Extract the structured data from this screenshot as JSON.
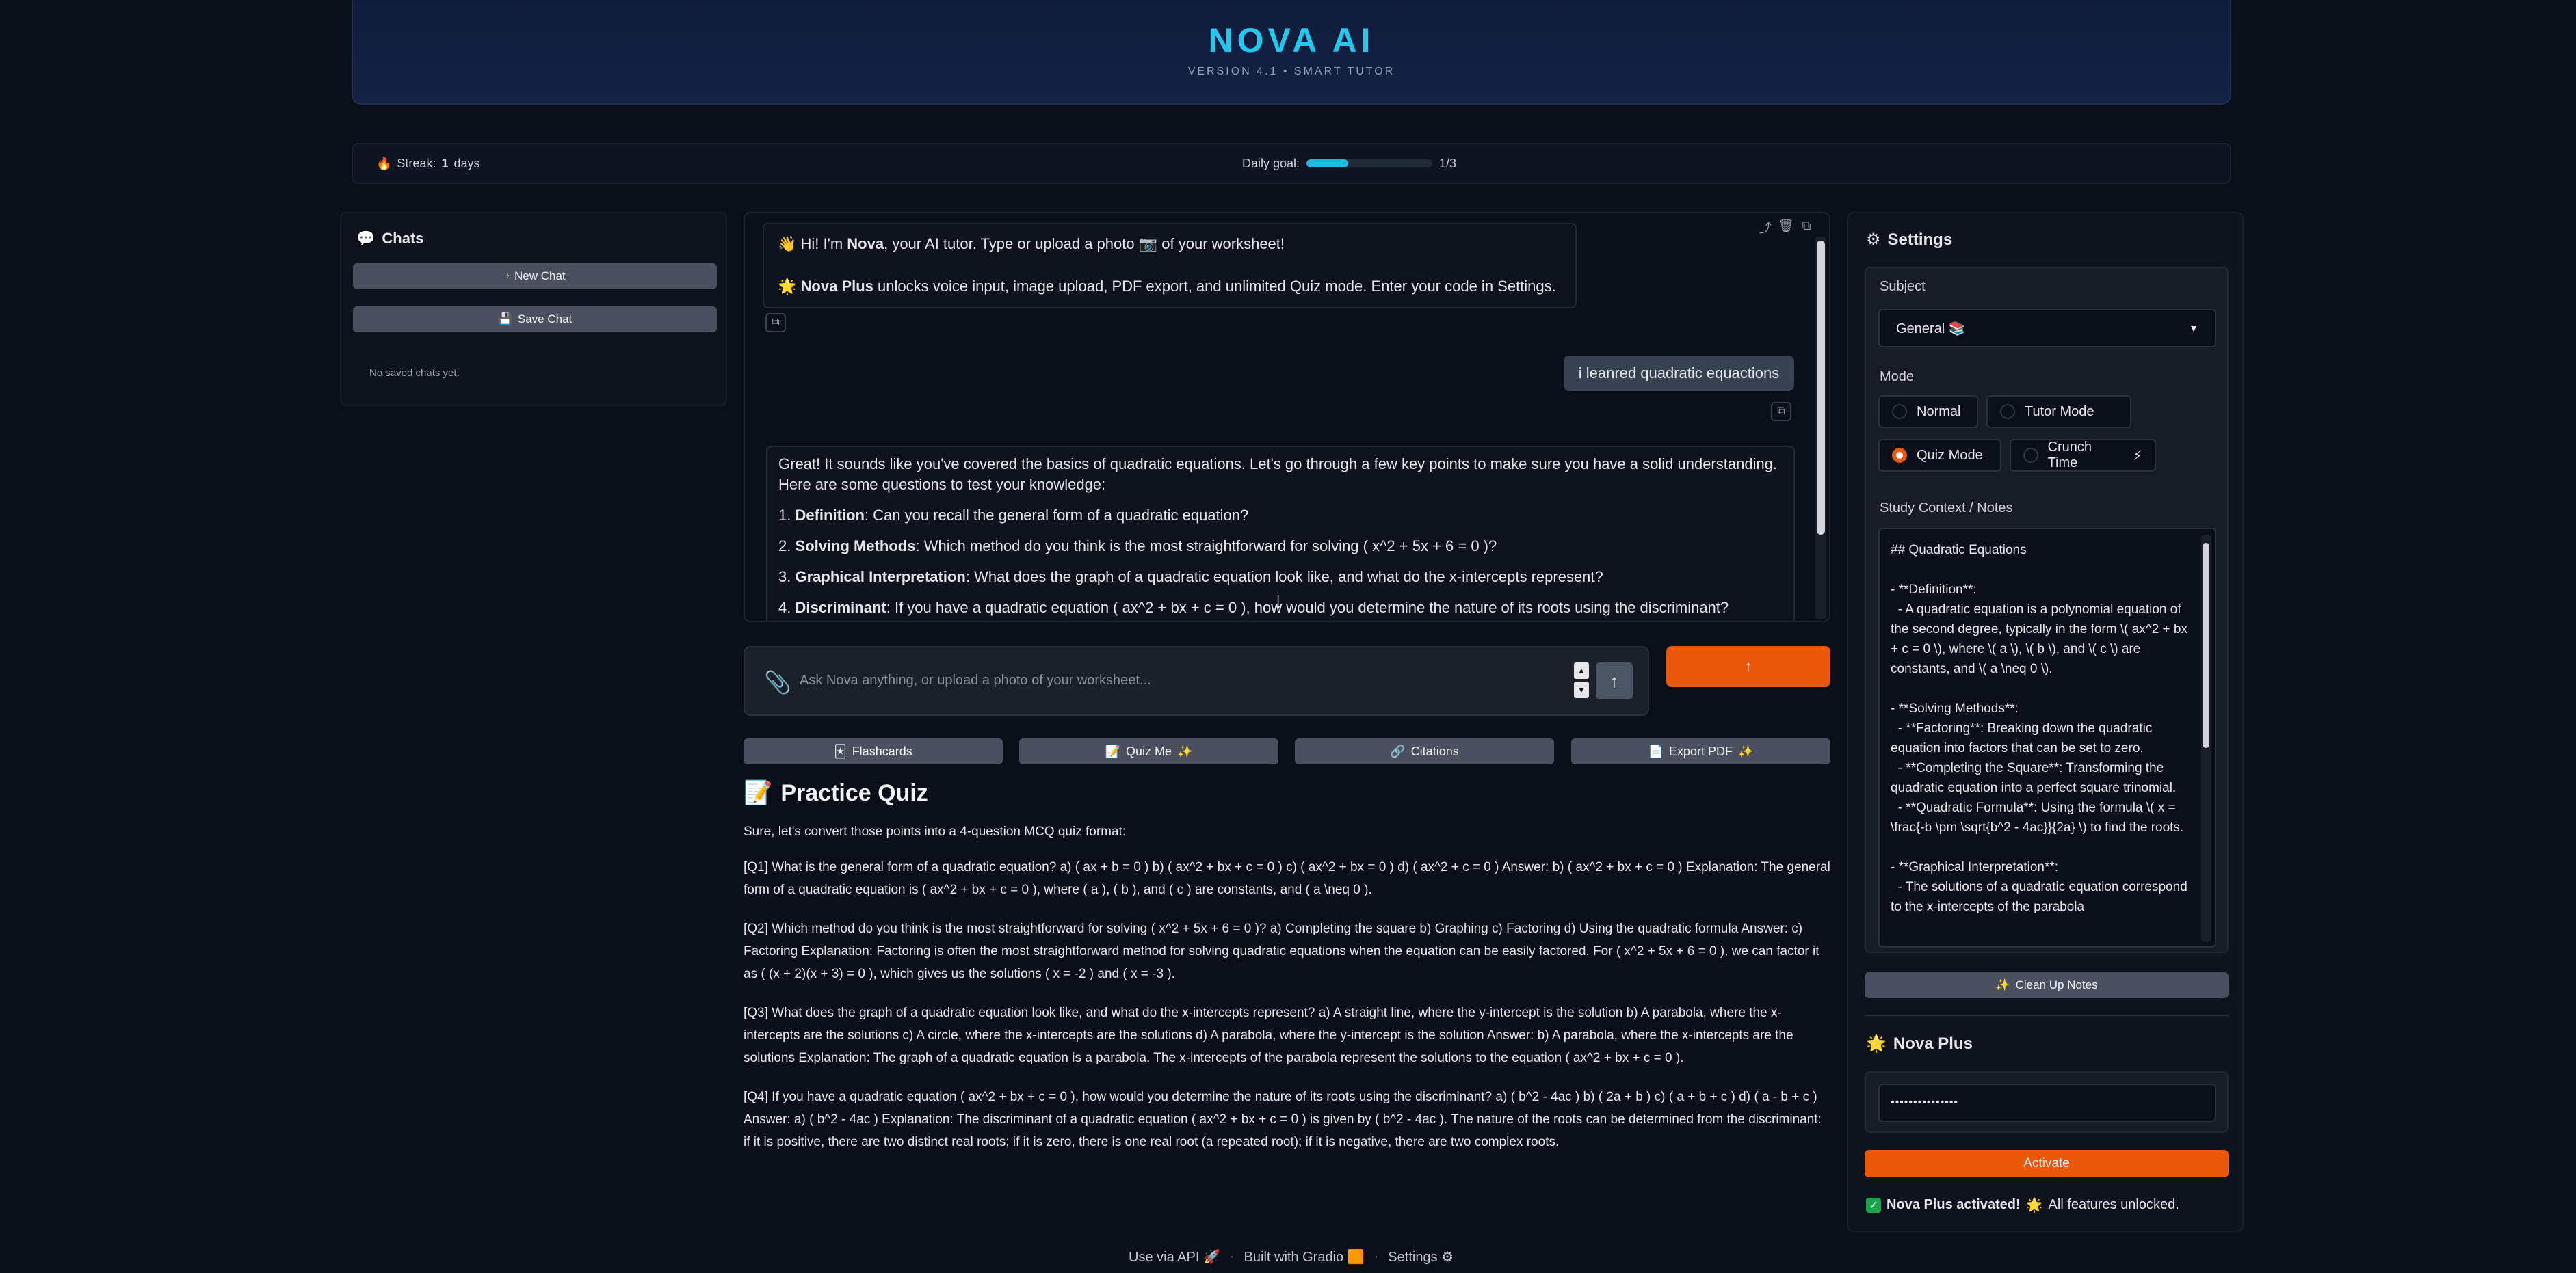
{
  "header": {
    "brand": "NOVA AI",
    "version": "VERSION 4.1 • SMART TUTOR"
  },
  "status": {
    "streak_label": "Streak:",
    "streak_value": "1",
    "streak_unit": "days",
    "goal_label": "Daily goal:",
    "goal_text": "1/3",
    "goal_progress": 0.33
  },
  "chats": {
    "title": "Chats",
    "new_chat": "+ New Chat",
    "save_chat": "Save Chat",
    "empty": "No saved chats yet."
  },
  "chat": {
    "greeting_line1_pre": "Hi! I'm ",
    "greeting_name": "Nova",
    "greeting_line1_post": ", your AI tutor. Type or upload a photo",
    "greeting_line1_end": "of your worksheet!",
    "greeting_line2_bold": "Nova Plus",
    "greeting_line2": " unlocks voice input, image upload, PDF export, and unlimited Quiz mode. Enter your code in Settings.",
    "user_message": "i leanred quadratic equactions",
    "bot_intro": "Great! It sounds like you've covered the basics of quadratic equations. Let's go through a few key points to make sure you have a solid understanding. Here are some questions to test your knowledge:",
    "bot_points": [
      {
        "num": "1. ",
        "bold": "Definition",
        "text": ": Can you recall the general form of a quadratic equation?"
      },
      {
        "num": "2. ",
        "bold": "Solving Methods",
        "text": ": Which method do you think is the most straightforward for solving ( x^2 + 5x + 6 = 0 )?"
      },
      {
        "num": "3. ",
        "bold": "Graphical Interpretation",
        "text": ": What does the graph of a quadratic equation look like, and what do the x-intercepts represent?"
      },
      {
        "num": "4. ",
        "bold": "Discriminant",
        "text": ": If you have a quadratic equation ( ax^2 + bx + c = 0 ), how would you determine the nature of its roots using the discriminant?"
      }
    ]
  },
  "input": {
    "placeholder": "Ask Nova anything, or upload a photo of your worksheet..."
  },
  "actions": {
    "flashcards": "Flashcards",
    "quiz_me": "Quiz Me",
    "citations": "Citations",
    "export_pdf": "Export PDF"
  },
  "quiz": {
    "title": "Practice Quiz",
    "intro": "Sure, let's convert those points into a 4-question MCQ quiz format:",
    "questions": [
      "[Q1] What is the general form of a quadratic equation? a) ( ax + b = 0 ) b) ( ax^2 + bx + c = 0 ) c) ( ax^2 + bx = 0 ) d) ( ax^2 + c = 0 ) Answer: b) ( ax^2 + bx + c = 0 ) Explanation: The general form of a quadratic equation is ( ax^2 + bx + c = 0 ), where ( a ), ( b ), and ( c ) are constants, and ( a \\neq 0 ).",
      "[Q2] Which method do you think is the most straightforward for solving ( x^2 + 5x + 6 = 0 )? a) Completing the square b) Graphing c) Factoring d) Using the quadratic formula Answer: c) Factoring Explanation: Factoring is often the most straightforward method for solving quadratic equations when the equation can be easily factored. For ( x^2 + 5x + 6 = 0 ), we can factor it as ( (x + 2)(x + 3) = 0 ), which gives us the solutions ( x = -2 ) and ( x = -3 ).",
      "[Q3] What does the graph of a quadratic equation look like, and what do the x-intercepts represent? a) A straight line, where the y-intercept is the solution b) A parabola, where the x-intercepts are the solutions c) A circle, where the x-intercepts are the solutions d) A parabola, where the y-intercept is the solution Answer: b) A parabola, where the x-intercepts are the solutions Explanation: The graph of a quadratic equation is a parabola. The x-intercepts of the parabola represent the solutions to the equation ( ax^2 + bx + c = 0 ).",
      "[Q4] If you have a quadratic equation ( ax^2 + bx + c = 0 ), how would you determine the nature of its roots using the discriminant? a) ( b^2 - 4ac ) b) ( 2a + b ) c) ( a + b + c ) d) ( a - b + c ) Answer: a) ( b^2 - 4ac ) Explanation: The discriminant of a quadratic equation ( ax^2 + bx + c = 0 ) is given by ( b^2 - 4ac ). The nature of the roots can be determined from the discriminant: if it is positive, there are two distinct real roots; if it is zero, there is one real root (a repeated root); if it is negative, there are two complex roots."
    ]
  },
  "footer": {
    "api": "Use via API",
    "built": "Built with Gradio",
    "settings": "Settings"
  },
  "settings": {
    "title": "Settings",
    "subject_label": "Subject",
    "subject_value": "General",
    "mode_label": "Mode",
    "modes": [
      "Normal",
      "Tutor Mode",
      "Quiz Mode",
      "Crunch Time"
    ],
    "mode_selected": "Quiz Mode",
    "notes_label": "Study Context / Notes",
    "notes": "## Quadratic Equations\n\n- **Definition**:\n  - A quadratic equation is a polynomial equation of the second degree, typically in the form \\( ax^2 + bx + c = 0 \\), where \\( a \\), \\( b \\), and \\( c \\) are constants, and \\( a \\neq 0 \\).\n\n- **Solving Methods**:\n  - **Factoring**: Breaking down the quadratic equation into factors that can be set to zero.\n  - **Completing the Square**: Transforming the quadratic equation into a perfect square trinomial.\n  - **Quadratic Formula**: Using the formula \\( x = \\frac{-b \\pm \\sqrt{b^2 - 4ac}}{2a} \\) to find the roots.\n\n- **Graphical Interpretation**:\n  - The solutions of a quadratic equation correspond to the x-intercepts of the parabola",
    "cleanup": "Clean Up Notes",
    "plus_title": "Nova Plus",
    "code_value": "•••••••••••••••",
    "activate": "Activate",
    "activated_bold": "Nova Plus activated!",
    "activated_text": "All features unlocked."
  },
  "colors": {
    "accent": "#ea580c",
    "brand": "#22c8ee",
    "background": "#0b0f19"
  }
}
